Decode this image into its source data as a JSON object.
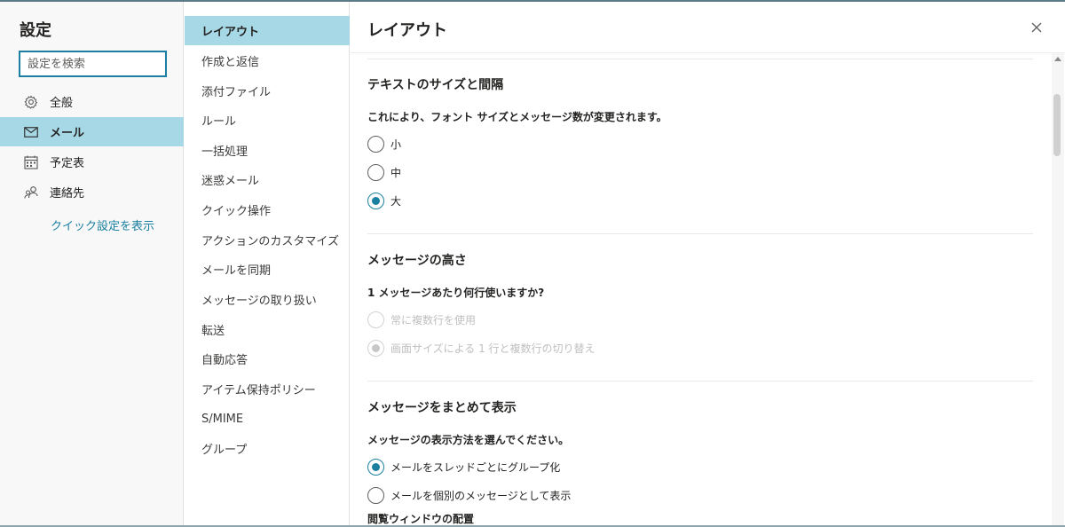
{
  "left": {
    "title": "設定",
    "search_placeholder": "設定を検索",
    "categories": [
      {
        "label": "全般",
        "icon": "gear-icon",
        "active": false
      },
      {
        "label": "メール",
        "icon": "mail-icon",
        "active": true
      },
      {
        "label": "予定表",
        "icon": "calendar-icon",
        "active": false
      },
      {
        "label": "連絡先",
        "icon": "people-icon",
        "active": false
      }
    ],
    "quick_settings_link": "クイック設定を表示"
  },
  "middle": {
    "items": [
      "レイアウト",
      "作成と返信",
      "添付ファイル",
      "ルール",
      "一括処理",
      "迷惑メール",
      "クイック操作",
      "アクションのカスタマイズ",
      "メールを同期",
      "メッセージの取り扱い",
      "転送",
      "自動応答",
      "アイテム保持ポリシー",
      "S/MIME",
      "グループ"
    ],
    "active_index": 0
  },
  "content": {
    "title": "レイアウト",
    "close_icon": "close-icon",
    "text_size": {
      "title": "テキストのサイズと間隔",
      "description": "これにより、フォント サイズとメッセージ数が変更されます。",
      "options": [
        {
          "label": "小",
          "checked": false
        },
        {
          "label": "中",
          "checked": false
        },
        {
          "label": "大",
          "checked": true
        }
      ]
    },
    "message_height": {
      "title": "メッセージの高さ",
      "description": "1 メッセージあたり何行使いますか?",
      "options": [
        {
          "label": "常に複数行を使用",
          "checked": false,
          "disabled": true
        },
        {
          "label": "画面サイズによる 1 行と複数行の切り替え",
          "checked": true,
          "disabled": true
        }
      ]
    },
    "grouping": {
      "title": "メッセージをまとめて表示",
      "description": "メッセージの表示方法を選んでください。",
      "options": [
        {
          "label": "メールをスレッドごとにグループ化",
          "checked": true
        },
        {
          "label": "メールを個別のメッセージとして表示",
          "checked": false
        }
      ]
    },
    "reading_pane": {
      "title": "閲覧ウィンドウの配置"
    }
  },
  "colors": {
    "accent": "#1a7fa0",
    "active_bg": "#a6d8e6"
  }
}
